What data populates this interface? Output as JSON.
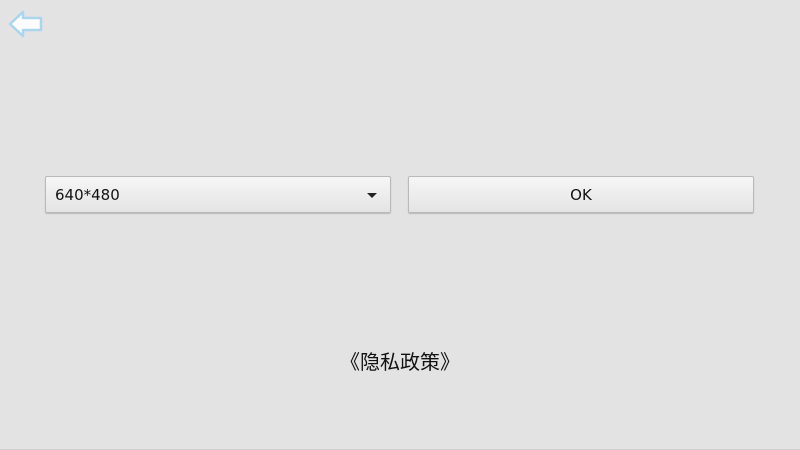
{
  "header": {
    "back_icon": "arrow-left-icon",
    "back_icon_color": "#a9d6ee"
  },
  "resolution_select": {
    "selected_value": "640*480",
    "caret_icon": "caret-down-icon"
  },
  "ok_button": {
    "label": "OK"
  },
  "privacy_link": {
    "label": "《隐私政策》"
  }
}
